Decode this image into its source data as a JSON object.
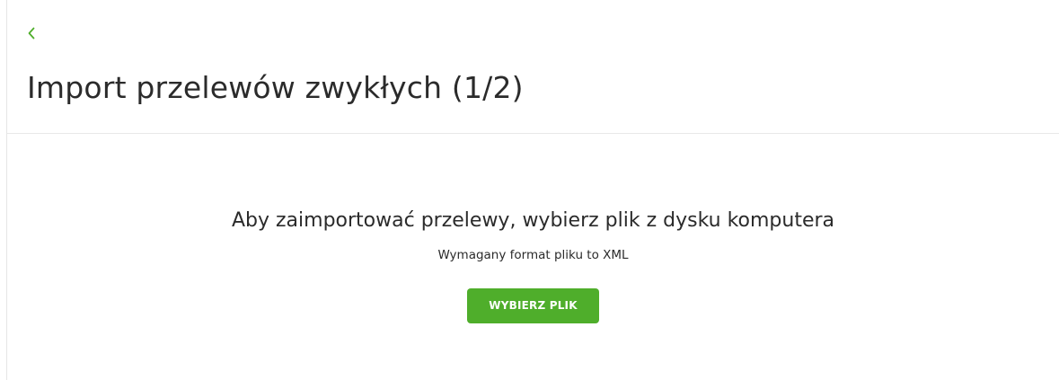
{
  "colors": {
    "accent": "#4fae2b",
    "text": "#2b2b2b",
    "divider": "#e8e8e8"
  },
  "header": {
    "back_icon": "chevron-left-icon",
    "title": "Import przelewów zwykłych (1/2)"
  },
  "main": {
    "instruction": "Aby zaimportować przelewy, wybierz plik z dysku komputera",
    "format_hint": "Wymagany format pliku to XML",
    "choose_file_label": "WYBIERZ PLIK"
  }
}
